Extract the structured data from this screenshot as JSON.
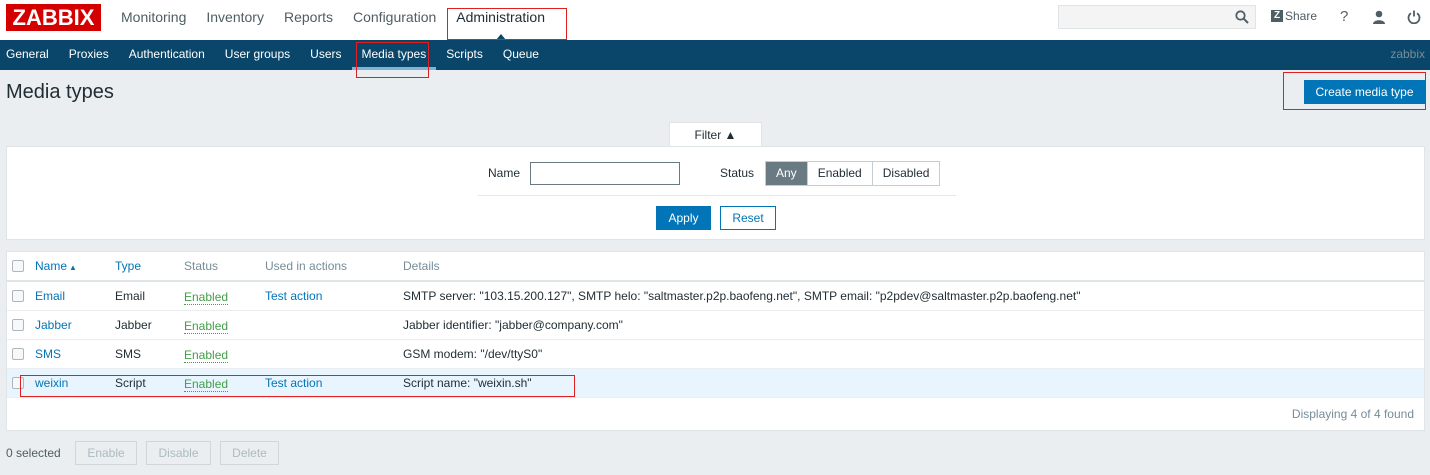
{
  "app": {
    "logo": "ZABBIX",
    "server_name": "zabbix"
  },
  "top_nav": {
    "items": [
      "Monitoring",
      "Inventory",
      "Reports",
      "Configuration",
      "Administration"
    ],
    "active": "Administration"
  },
  "header_tools": {
    "share_label": "Share",
    "help_label": "?"
  },
  "sub_nav": {
    "items": [
      "General",
      "Proxies",
      "Authentication",
      "User groups",
      "Users",
      "Media types",
      "Scripts",
      "Queue"
    ],
    "active": "Media types"
  },
  "page": {
    "title": "Media types",
    "create_button": "Create media type"
  },
  "filter": {
    "tab_label": "Filter ▲",
    "name_label": "Name",
    "name_value": "",
    "status_label": "Status",
    "status_options": [
      "Any",
      "Enabled",
      "Disabled"
    ],
    "status_selected": "Any",
    "apply_label": "Apply",
    "reset_label": "Reset"
  },
  "table": {
    "columns": [
      "Name",
      "Type",
      "Status",
      "Used in actions",
      "Details"
    ],
    "sort_indicator": "▲",
    "rows": [
      {
        "name": "Email",
        "type": "Email",
        "status": "Enabled",
        "used_in": "Test action",
        "details": "SMTP server: \"103.15.200.127\", SMTP helo: \"saltmaster.p2p.baofeng.net\", SMTP email: \"p2pdev@saltmaster.p2p.baofeng.net\""
      },
      {
        "name": "Jabber",
        "type": "Jabber",
        "status": "Enabled",
        "used_in": "",
        "details": "Jabber identifier: \"jabber@company.com\""
      },
      {
        "name": "SMS",
        "type": "SMS",
        "status": "Enabled",
        "used_in": "",
        "details": "GSM modem: \"/dev/ttyS0\""
      },
      {
        "name": "weixin",
        "type": "Script",
        "status": "Enabled",
        "used_in": "Test action",
        "details": "Script name: \"weixin.sh\""
      }
    ],
    "footer": "Displaying 4 of 4 found"
  },
  "bulk_actions": {
    "selected": "0 selected",
    "enable": "Enable",
    "disable": "Disable",
    "delete": "Delete"
  },
  "colors": {
    "brand_red": "#d40000",
    "nav_blue": "#0a466a",
    "primary_button": "#0275b8",
    "enabled_green": "#429e47",
    "annotation_red": "#e02020"
  }
}
